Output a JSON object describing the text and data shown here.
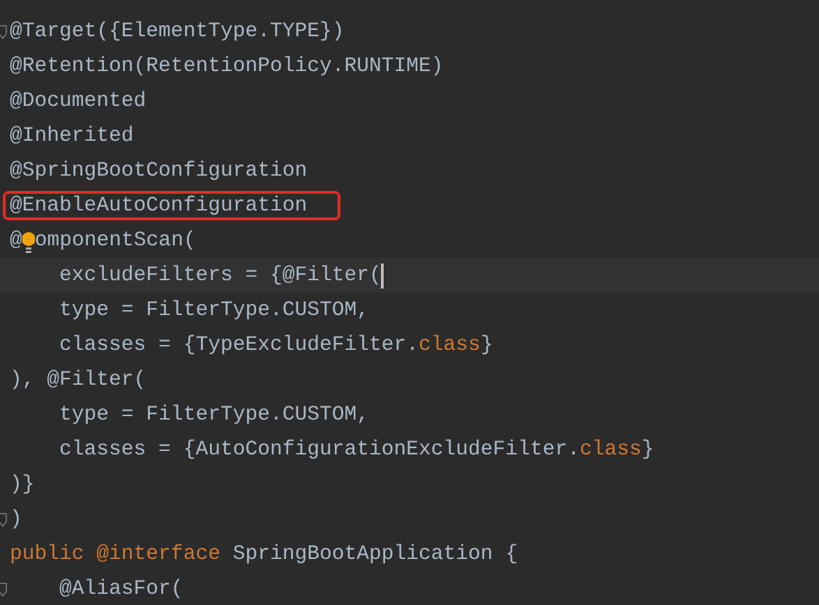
{
  "editor": {
    "lines": [
      {
        "fold": true,
        "current": false,
        "boxed": false,
        "tokens": [
          {
            "kind": "plain",
            "text": "@Target({ElementType.TYPE})"
          }
        ]
      },
      {
        "fold": false,
        "current": false,
        "boxed": false,
        "tokens": [
          {
            "kind": "plain",
            "text": "@Retention(RetentionPolicy.RUNTIME)"
          }
        ]
      },
      {
        "fold": false,
        "current": false,
        "boxed": false,
        "tokens": [
          {
            "kind": "plain",
            "text": "@Documented"
          }
        ]
      },
      {
        "fold": false,
        "current": false,
        "boxed": false,
        "tokens": [
          {
            "kind": "plain",
            "text": "@Inherited"
          }
        ]
      },
      {
        "fold": false,
        "current": false,
        "boxed": false,
        "tokens": [
          {
            "kind": "plain",
            "text": "@SpringBootConfiguration"
          }
        ]
      },
      {
        "fold": false,
        "current": false,
        "boxed": true,
        "tokens": [
          {
            "kind": "plain",
            "text": "@EnableAutoConfiguration"
          }
        ]
      },
      {
        "fold": false,
        "current": false,
        "boxed": false,
        "tokens": [
          {
            "kind": "plain",
            "text": "@"
          },
          {
            "kind": "bulb"
          },
          {
            "kind": "plain",
            "text": "omponentScan("
          }
        ]
      },
      {
        "fold": false,
        "current": true,
        "boxed": false,
        "tokens": [
          {
            "kind": "plain",
            "text": "    excludeFilters = {@Filter("
          }
        ]
      },
      {
        "fold": false,
        "current": false,
        "boxed": false,
        "tokens": [
          {
            "kind": "plain",
            "text": "    type = FilterType.CUSTOM,"
          }
        ]
      },
      {
        "fold": false,
        "current": false,
        "boxed": false,
        "tokens": [
          {
            "kind": "plain",
            "text": "    classes = {TypeExcludeFilter."
          },
          {
            "kind": "keyword",
            "text": "class"
          },
          {
            "kind": "plain",
            "text": "}"
          }
        ]
      },
      {
        "fold": false,
        "current": false,
        "boxed": false,
        "tokens": [
          {
            "kind": "plain",
            "text": "), @Filter("
          }
        ]
      },
      {
        "fold": false,
        "current": false,
        "boxed": false,
        "tokens": [
          {
            "kind": "plain",
            "text": "    type = FilterType.CUSTOM,"
          }
        ]
      },
      {
        "fold": false,
        "current": false,
        "boxed": false,
        "tokens": [
          {
            "kind": "plain",
            "text": "    classes = {AutoConfigurationExcludeFilter."
          },
          {
            "kind": "keyword",
            "text": "class"
          },
          {
            "kind": "plain",
            "text": "}"
          }
        ]
      },
      {
        "fold": false,
        "current": false,
        "boxed": false,
        "tokens": [
          {
            "kind": "plain",
            "text": ")}"
          }
        ]
      },
      {
        "fold": true,
        "current": false,
        "boxed": false,
        "tokens": [
          {
            "kind": "plain",
            "text": ")"
          }
        ]
      },
      {
        "fold": false,
        "current": false,
        "boxed": false,
        "tokens": [
          {
            "kind": "keyword",
            "text": "public @interface "
          },
          {
            "kind": "plain",
            "text": "SpringBootApplication {"
          }
        ]
      },
      {
        "fold": true,
        "current": false,
        "boxed": false,
        "tokens": [
          {
            "kind": "plain",
            "text": "    @AliasFor("
          }
        ]
      }
    ]
  }
}
